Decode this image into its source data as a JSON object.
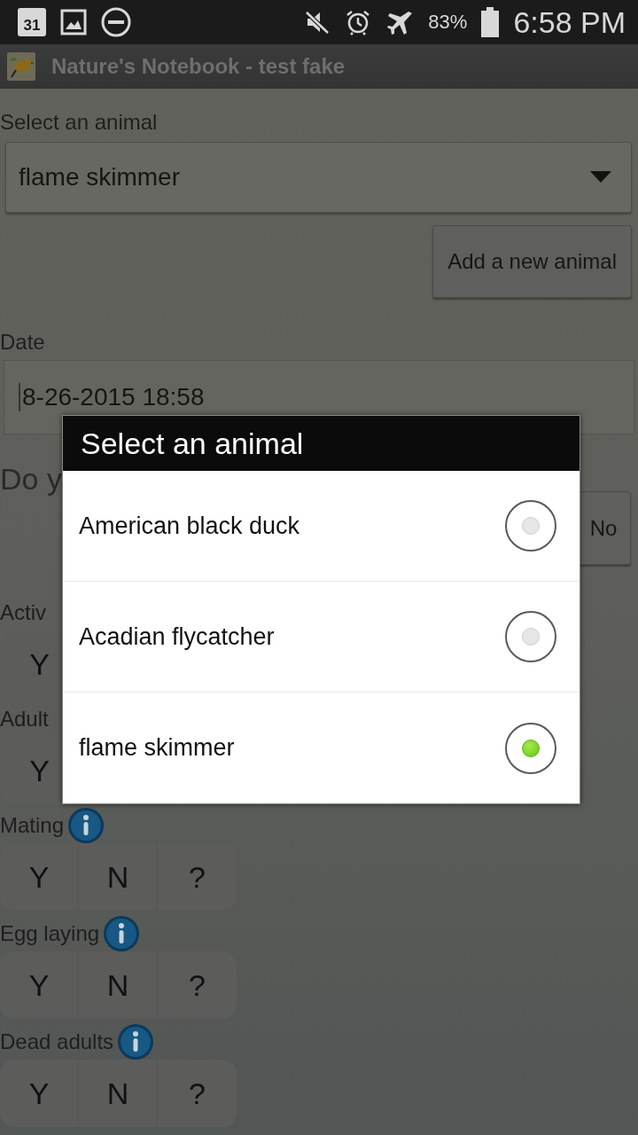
{
  "status_bar": {
    "calendar_day": "31",
    "battery": "83%",
    "time": "6:58 PM"
  },
  "app_bar": {
    "title": "Nature's Notebook - test fake"
  },
  "form": {
    "animal_label": "Select an animal",
    "animal_value": "flame skimmer",
    "add_button": "Add a new animal",
    "date_label": "Date",
    "date_value": "8-26-2015 18:58",
    "question": "Do y",
    "no_button": "No",
    "sections": [
      {
        "label": "Activ",
        "info": false,
        "options": [
          "Y"
        ]
      },
      {
        "label": "Adult",
        "info": false,
        "options": [
          "Y"
        ]
      },
      {
        "label": "Mating",
        "info": true,
        "options": [
          "Y",
          "N",
          "?"
        ]
      },
      {
        "label": "Egg laying",
        "info": true,
        "options": [
          "Y",
          "N",
          "?"
        ]
      },
      {
        "label": "Dead adults",
        "info": true,
        "options": [
          "Y",
          "N",
          "?"
        ]
      }
    ]
  },
  "dialog": {
    "title": "Select an animal",
    "options": [
      {
        "label": "American black duck",
        "selected": false
      },
      {
        "label": "Acadian flycatcher",
        "selected": false
      },
      {
        "label": "flame skimmer",
        "selected": true
      }
    ]
  }
}
